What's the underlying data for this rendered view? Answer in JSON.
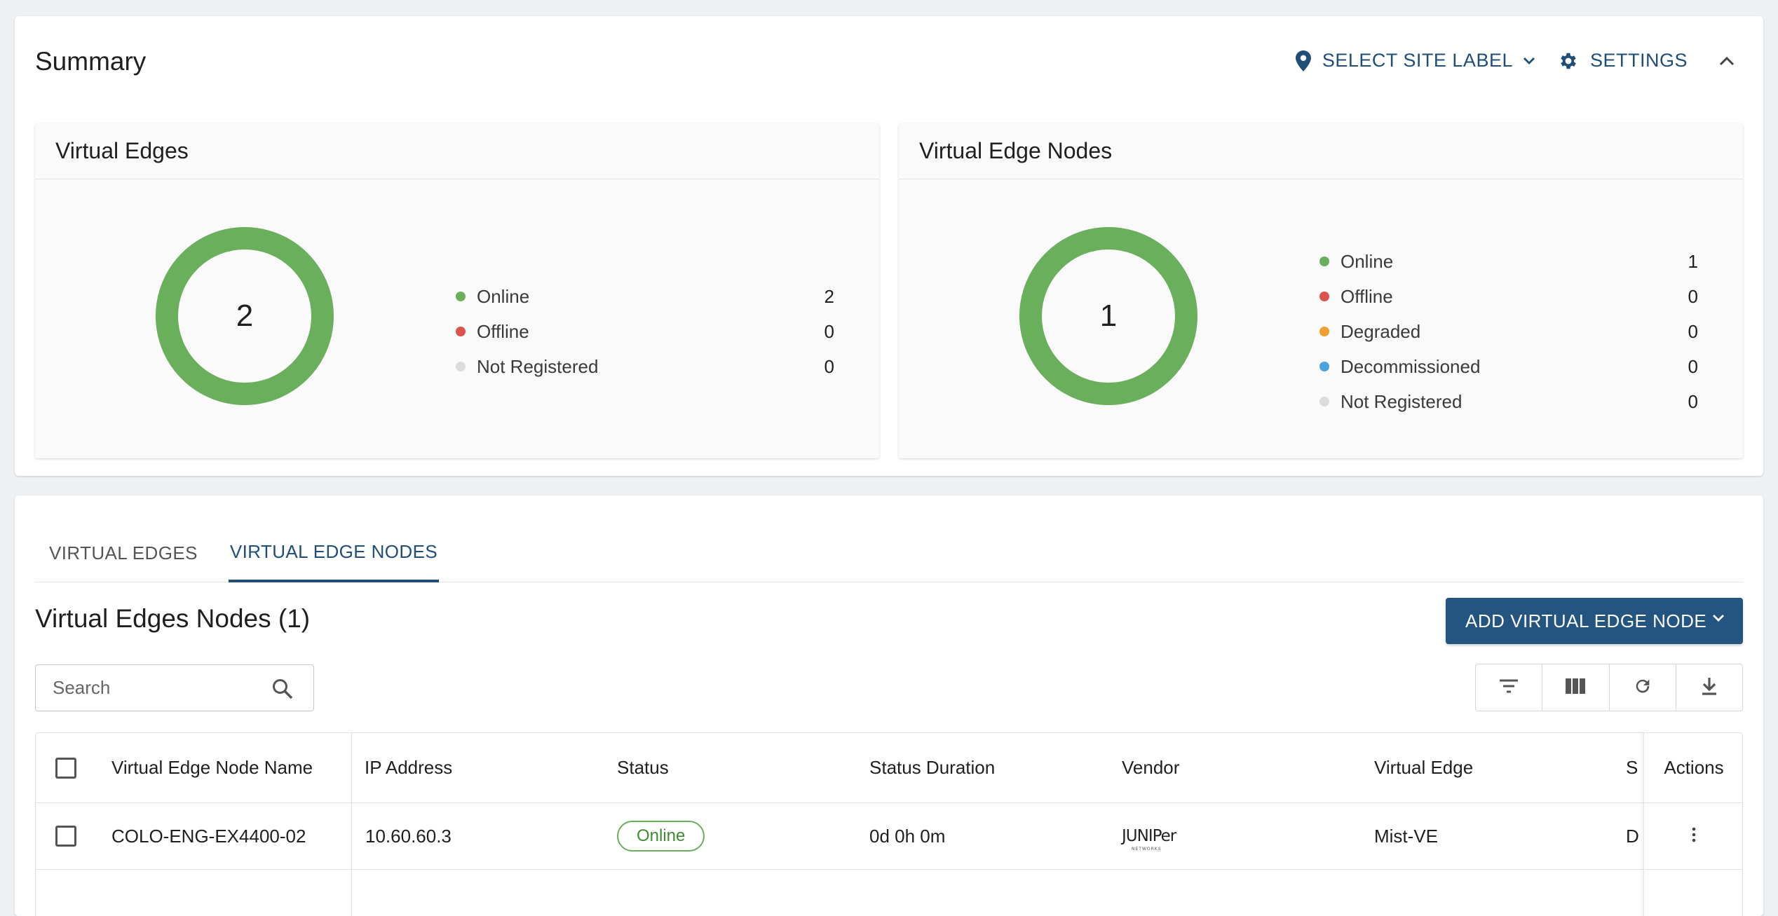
{
  "summary": {
    "title": "Summary",
    "site_label": "SELECT SITE LABEL",
    "settings": "SETTINGS"
  },
  "virtual_edges_panel": {
    "title": "Virtual Edges",
    "total": "2",
    "legend": [
      {
        "label": "Online",
        "value": "2",
        "color": "#6aaf5c"
      },
      {
        "label": "Offline",
        "value": "0",
        "color": "#d9534f"
      },
      {
        "label": "Not Registered",
        "value": "0",
        "color": "#dcdcdc"
      }
    ]
  },
  "virtual_edge_nodes_panel": {
    "title": "Virtual Edge Nodes",
    "total": "1",
    "legend": [
      {
        "label": "Online",
        "value": "1",
        "color": "#6aaf5c"
      },
      {
        "label": "Offline",
        "value": "0",
        "color": "#d9534f"
      },
      {
        "label": "Degraded",
        "value": "0",
        "color": "#f0a030"
      },
      {
        "label": "Decommissioned",
        "value": "0",
        "color": "#4aa3df"
      },
      {
        "label": "Not Registered",
        "value": "0",
        "color": "#dcdcdc"
      }
    ]
  },
  "tabs": [
    {
      "label": "VIRTUAL EDGES",
      "active": false
    },
    {
      "label": "VIRTUAL EDGE NODES",
      "active": true
    }
  ],
  "list": {
    "title": "Virtual Edges Nodes (1)",
    "add_button": "ADD VIRTUAL EDGE NODE",
    "search_placeholder": "Search"
  },
  "table": {
    "headers": {
      "name": "Virtual Edge Node Name",
      "ip": "IP Address",
      "status": "Status",
      "duration": "Status Duration",
      "vendor": "Vendor",
      "virtual_edge": "Virtual Edge",
      "truncated": "S",
      "actions": "Actions"
    },
    "rows": [
      {
        "name": "COLO-ENG-EX4400-02",
        "ip": "10.60.60.3",
        "status": "Online",
        "duration": "0d 0h 0m",
        "vendor": "JUNIPer",
        "vendor_sub": "NETWORKS",
        "virtual_edge": "Mist-VE",
        "truncated": "D"
      }
    ]
  },
  "colors": {
    "accent": "#1f4e79",
    "button": "#245581",
    "online": "#6aaf5c"
  }
}
